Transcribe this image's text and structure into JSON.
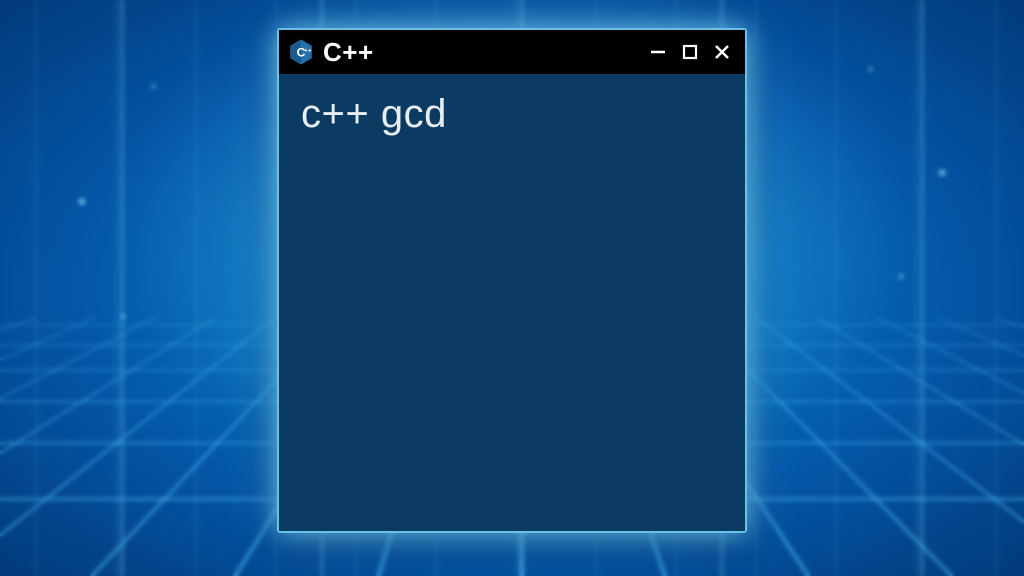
{
  "window": {
    "title": "C++",
    "body_text": "c++  gcd",
    "icon_name": "cpp-logo"
  },
  "colors": {
    "window_bg": "#0b3a62",
    "titlebar_bg": "#000000",
    "border": "#6ac0ea",
    "text": "#e8eef2"
  }
}
